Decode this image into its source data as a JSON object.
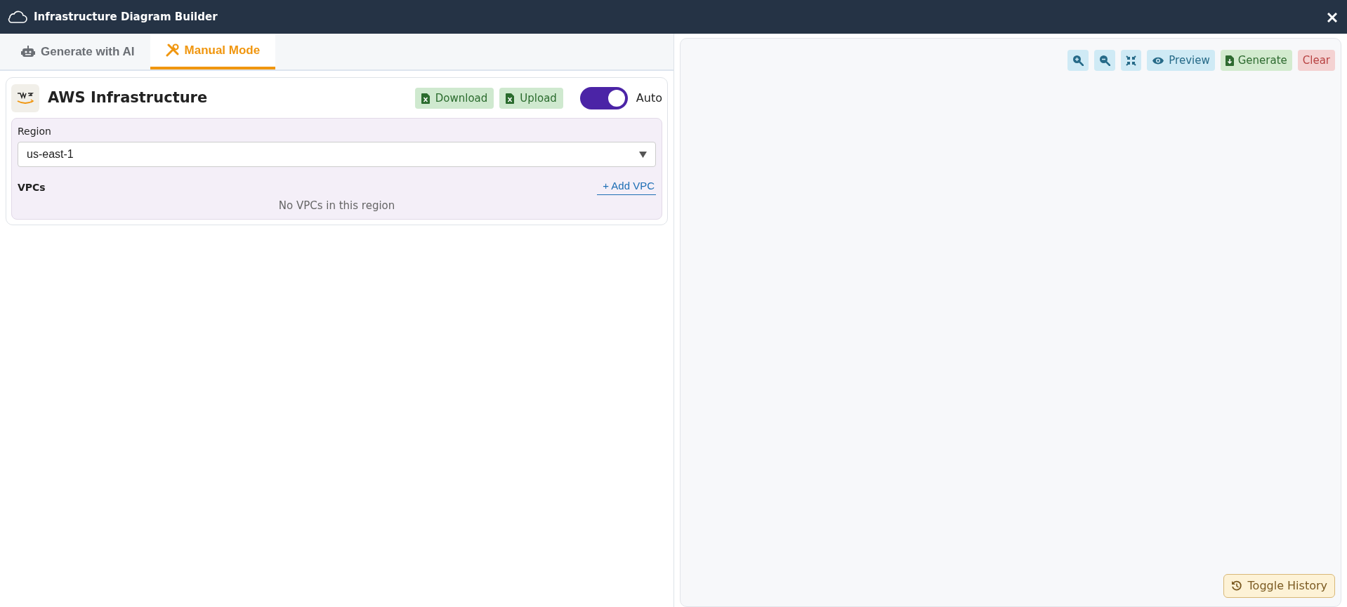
{
  "window": {
    "title": "Infrastructure Diagram Builder"
  },
  "tabs": [
    {
      "label": "Generate with AI",
      "selected": false
    },
    {
      "label": "Manual Mode",
      "selected": true
    }
  ],
  "provider": {
    "title": "AWS Infrastructure",
    "buttons": [
      {
        "label": "Download"
      },
      {
        "label": "Upload"
      }
    ],
    "auto": {
      "label": "Auto",
      "on": true
    }
  },
  "region": {
    "label": "Region",
    "value": "us-east-1"
  },
  "vpcs": {
    "label": "VPCs",
    "add_link": "+ Add VPC",
    "empty_message": "No VPCs in this region"
  },
  "toolbar": [
    {
      "kind": "zoom-in"
    },
    {
      "kind": "zoom-out"
    },
    {
      "kind": "fit"
    },
    {
      "kind": "preview",
      "label": "Preview"
    },
    {
      "kind": "generate",
      "label": "Generate"
    },
    {
      "kind": "clear",
      "label": "Clear"
    }
  ],
  "history_button": {
    "label": "Toggle History"
  }
}
